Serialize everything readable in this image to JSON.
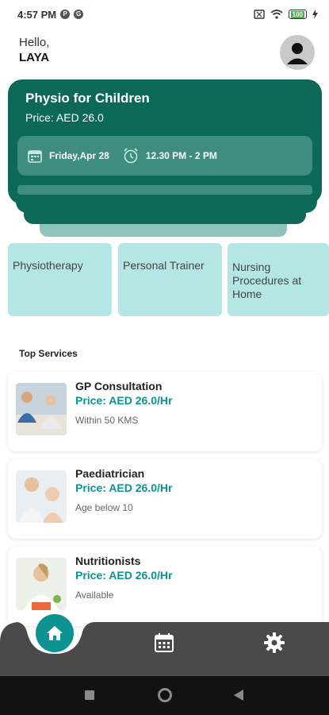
{
  "status_bar": {
    "time": "4:57 PM",
    "battery": "100"
  },
  "greeting": {
    "hello": "Hello,",
    "name": "LAYA"
  },
  "appointment": {
    "title": "Physio for Children",
    "price": "Price: AED 26.0",
    "date": "Friday,Apr 28",
    "time": "12.30 PM - 2 PM"
  },
  "categories": [
    "Physiotherapy",
    "Personal Trainer",
    "Nursing Procedures at Home"
  ],
  "top_services_title": "Top Services",
  "services": [
    {
      "name": "GP Consultation",
      "price": "Price: AED 26.0/Hr",
      "sub": "Within 50 KMS"
    },
    {
      "name": "Paediatrician",
      "price": "Price: AED 26.0/Hr",
      "sub": "Age below 10"
    },
    {
      "name": "Nutritionists",
      "price": "Price: AED 26.0/Hr",
      "sub": "Available"
    }
  ],
  "colors": {
    "primary_dark": "#0d6957",
    "accent_teal": "#0d9292",
    "tile_bg": "#b5e6e6",
    "nav_bg": "#4a4a4a"
  },
  "nav": {
    "home": "home-icon",
    "calendar": "calendar-icon",
    "settings": "gear-icon"
  }
}
